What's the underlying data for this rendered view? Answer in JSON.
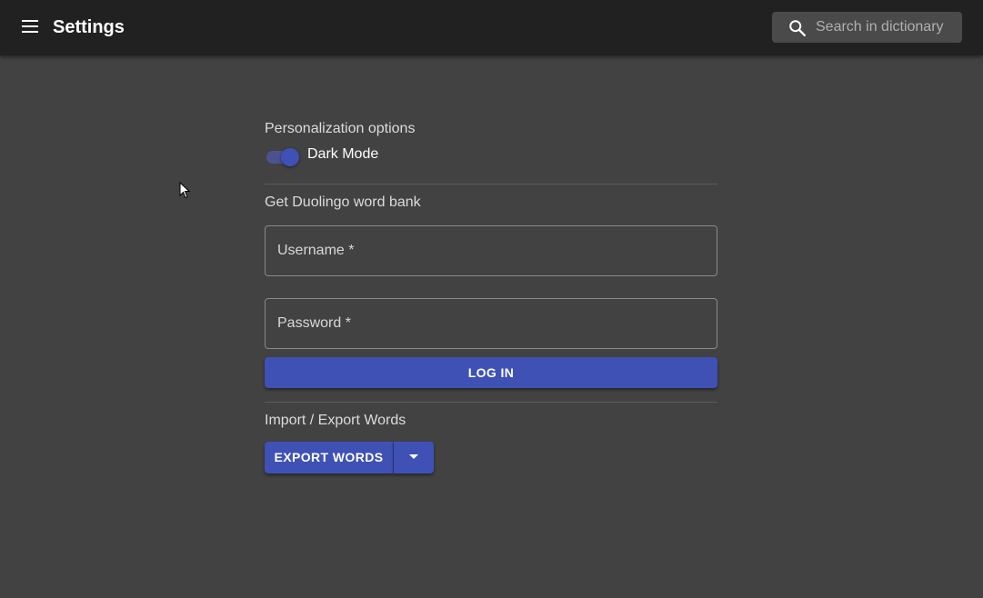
{
  "appbar": {
    "title": "Settings",
    "menu_icon": "hamburger-menu-icon",
    "search": {
      "icon": "search-icon",
      "placeholder": "Search in dictionary",
      "value": ""
    }
  },
  "settings": {
    "personalization": {
      "title": "Personalization options",
      "dark_mode": {
        "label": "Dark Mode",
        "checked": true
      }
    },
    "duolingo": {
      "title": "Get Duolingo word bank",
      "username_label": "Username *",
      "username_value": "",
      "password_label": "Password *",
      "password_value": "",
      "login_label": "LOG IN"
    },
    "import_export": {
      "title": "Import / Export Words",
      "export_label": "EXPORT WORDS",
      "dropdown_icon": "arrow-drop-down-icon"
    }
  },
  "colors": {
    "primary": "#3f51b5",
    "background": "#424242",
    "appbar": "#212121"
  }
}
